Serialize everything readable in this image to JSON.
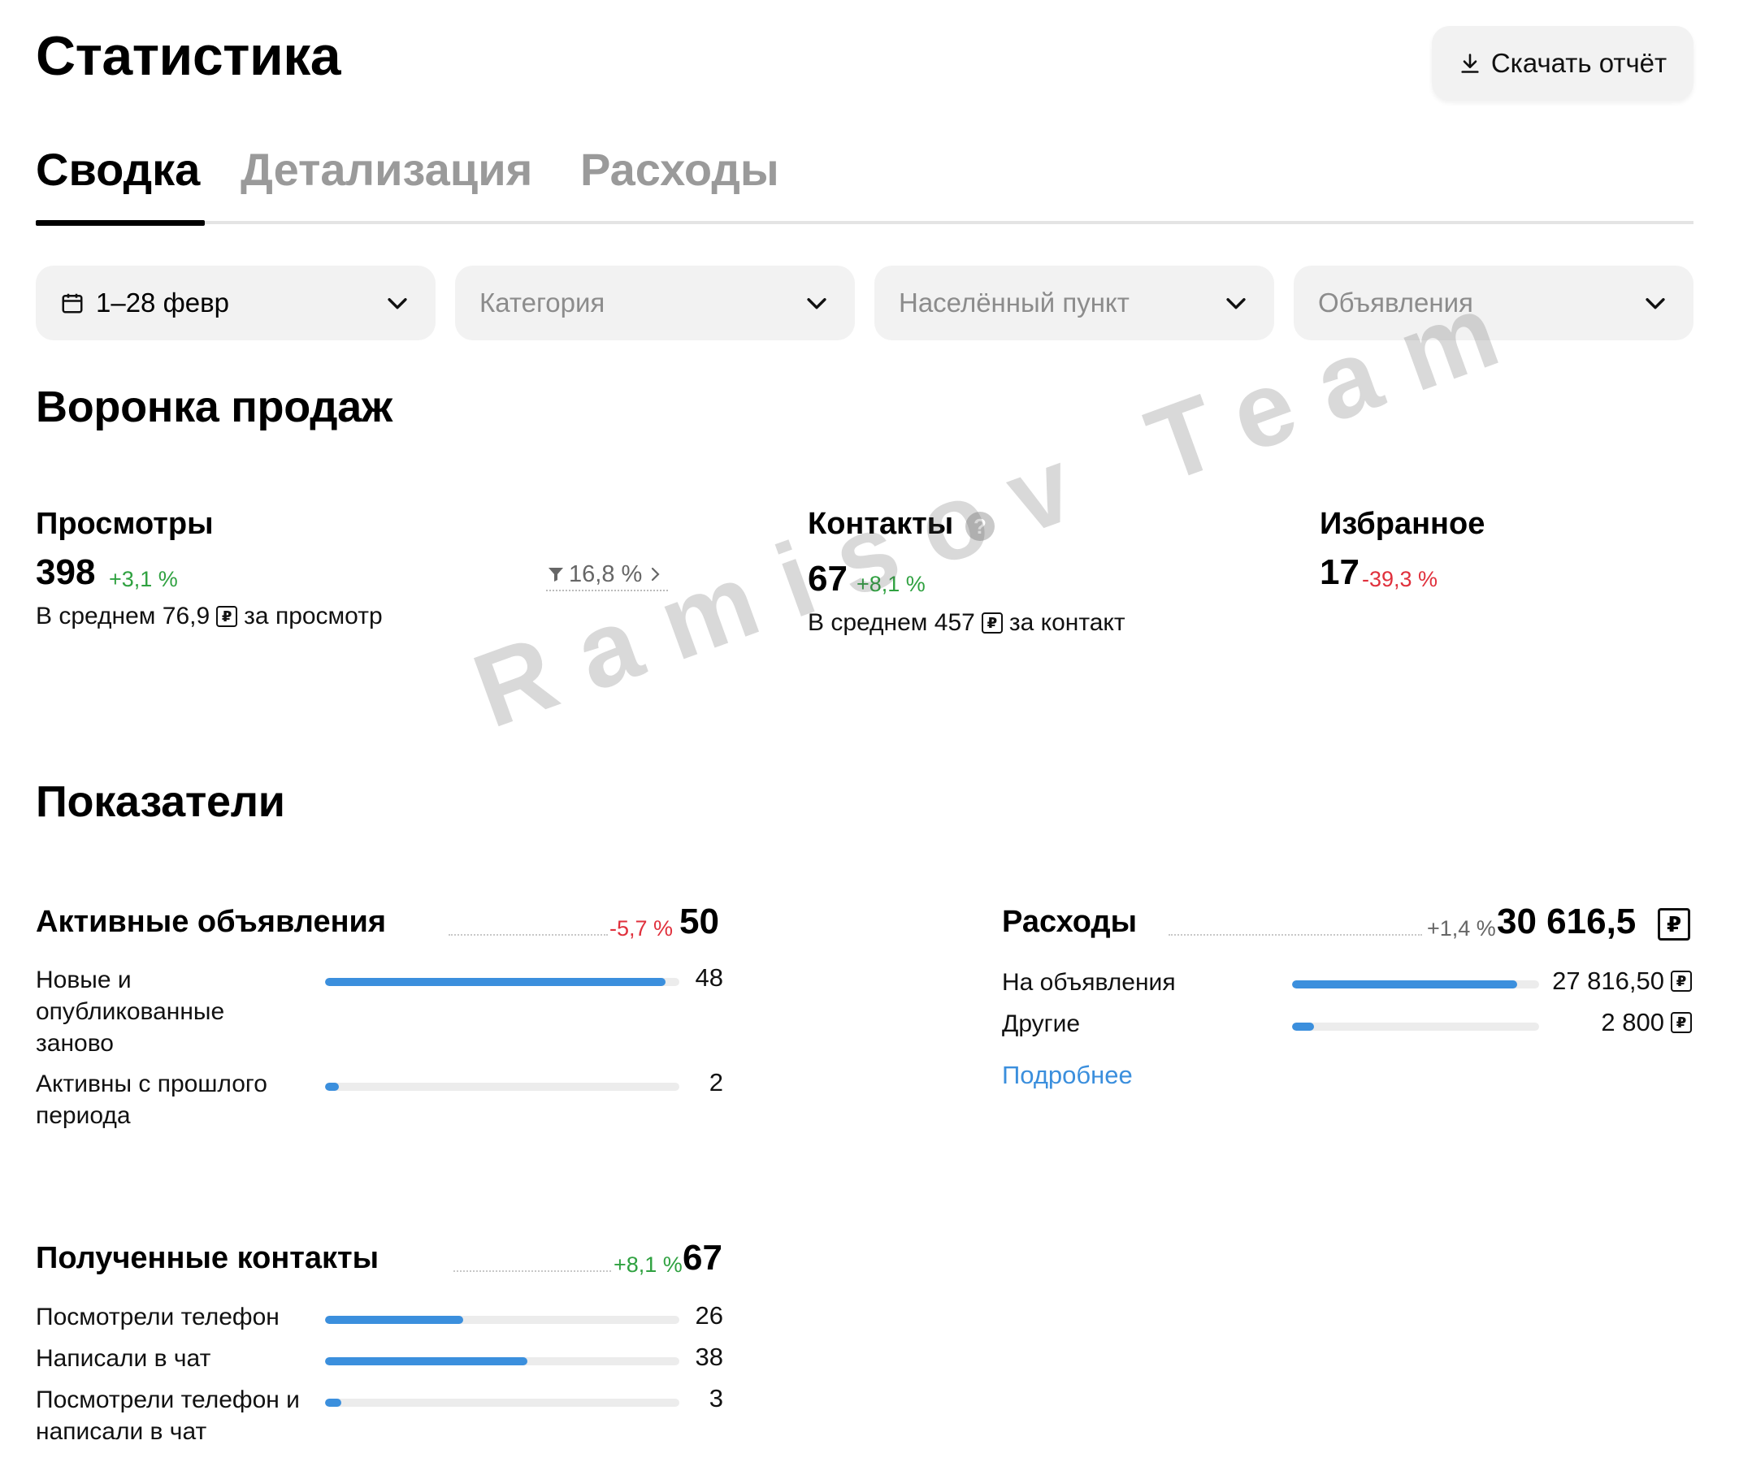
{
  "header": {
    "title": "Статистика",
    "download_label": "Скачать отчёт"
  },
  "tabs": [
    {
      "label": "Сводка",
      "active": true
    },
    {
      "label": "Детализация",
      "active": false
    },
    {
      "label": "Расходы",
      "active": false
    }
  ],
  "filters": {
    "date": "1–28 февр",
    "category": "Категория",
    "location": "Населённый пункт",
    "listings": "Объявления"
  },
  "funnel": {
    "title": "Воронка продаж",
    "views": {
      "label": "Просмотры",
      "value": "398",
      "delta": "+3,1 %",
      "avg_prefix": "В среднем 76,9",
      "avg_suffix": "за просмотр",
      "conversion": "16,8 %"
    },
    "contacts": {
      "label": "Контакты",
      "value": "67",
      "delta": "+8,1 %",
      "avg_prefix": "В среднем 457",
      "avg_suffix": "за контакт"
    },
    "favorites": {
      "label": "Избранное",
      "value": "17",
      "delta": "-39,3 %"
    }
  },
  "metrics": {
    "title": "Показатели",
    "active_listings": {
      "label": "Активные объявления",
      "delta": "-5,7 %",
      "total": "50",
      "rows": [
        {
          "label": "Новые и опубликованные заново",
          "value": "48",
          "fill": 0.96
        },
        {
          "label": "Активны с прошлого периода",
          "value": "2",
          "fill": 0.04
        }
      ]
    },
    "expenses": {
      "label": "Расходы",
      "delta": "+1,4 %",
      "total": "30 616,5",
      "rows": [
        {
          "label": "На объявления",
          "value": "27 816,50",
          "fill": 0.91
        },
        {
          "label": "Другие",
          "value": "2 800",
          "fill": 0.09
        }
      ],
      "more_link": "Подробнее"
    },
    "received_contacts": {
      "label": "Полученные контакты",
      "delta": "+8,1 %",
      "total": "67",
      "rows": [
        {
          "label": "Посмотрели телефон",
          "value": "26",
          "fill": 0.39
        },
        {
          "label": "Написали в чат",
          "value": "38",
          "fill": 0.57
        },
        {
          "label": "Посмотрели телефон и написали в чат",
          "value": "3",
          "fill": 0.045
        }
      ]
    }
  },
  "currency_glyph": "₽",
  "watermark": "Ramisov Team",
  "colors": {
    "accent": "#3b8fdd",
    "positive": "#2fa140",
    "negative": "#e0303c",
    "chip_bg": "#f2f2f2"
  }
}
